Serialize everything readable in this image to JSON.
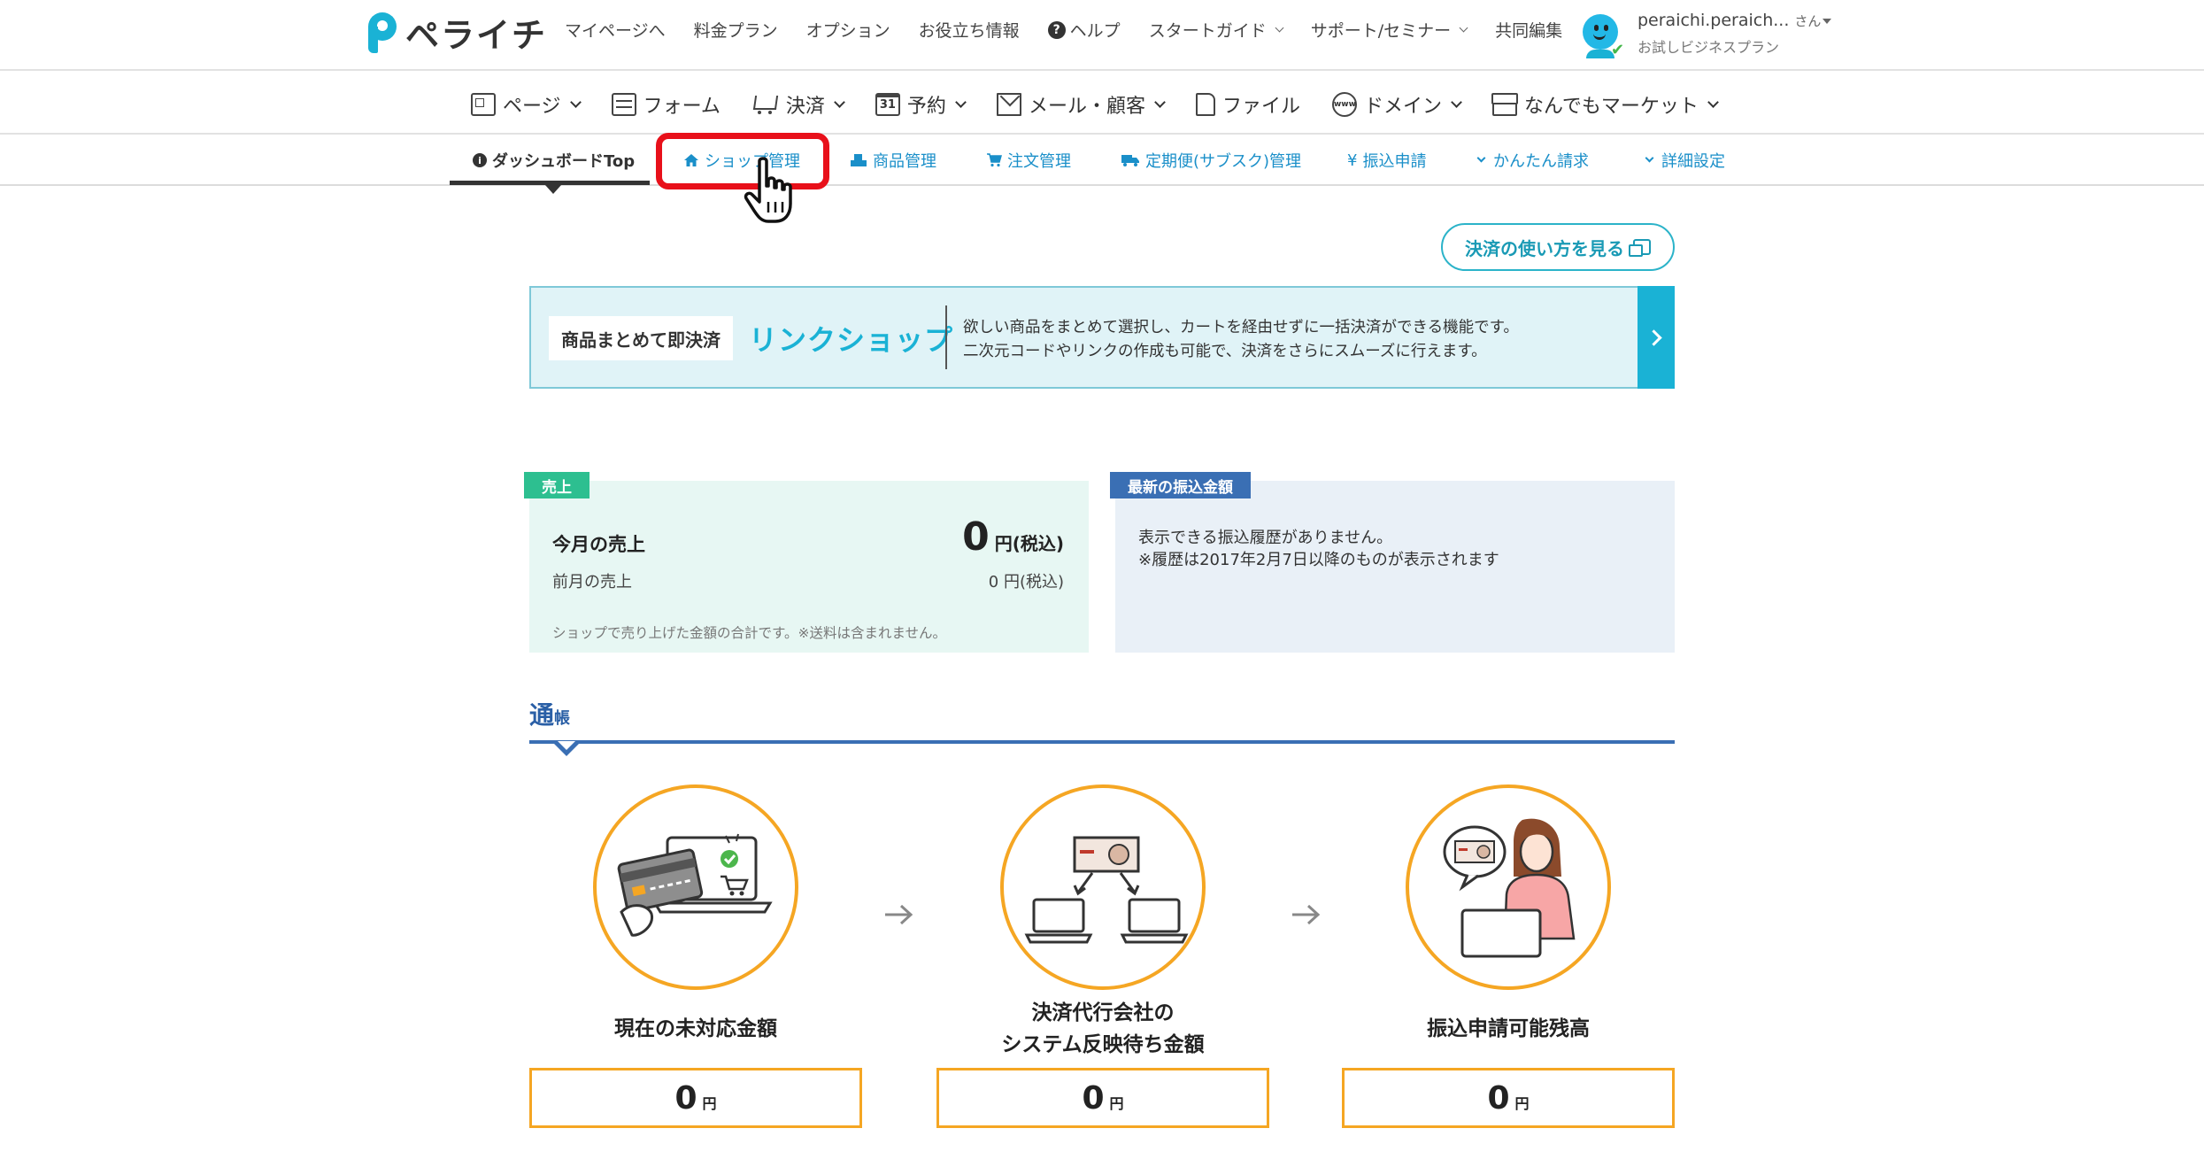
{
  "header": {
    "logo_text": "ペライチ",
    "nav": [
      {
        "label": "マイページへ",
        "dropdown": false
      },
      {
        "label": "料金プラン",
        "dropdown": false
      },
      {
        "label": "オプション",
        "dropdown": false
      },
      {
        "label": "お役立ち情報",
        "dropdown": false
      },
      {
        "label": "ヘルプ",
        "dropdown": false
      },
      {
        "label": "スタートガイド",
        "dropdown": true
      },
      {
        "label": "サポート/セミナー",
        "dropdown": true
      },
      {
        "label": "共同編集",
        "dropdown": false
      }
    ],
    "user": {
      "name": "peraichi.peraich...",
      "suffix": "さん",
      "plan": "お試しビジネスプラン"
    }
  },
  "main_nav": [
    {
      "label": "ページ",
      "icon": "page-icon"
    },
    {
      "label": "フォーム",
      "icon": "form-icon"
    },
    {
      "label": "決済",
      "icon": "cart-icon"
    },
    {
      "label": "予約",
      "icon": "calendar-icon"
    },
    {
      "label": "メール・顧客",
      "icon": "mail-icon"
    },
    {
      "label": "ファイル",
      "icon": "file-icon"
    },
    {
      "label": "ドメイン",
      "icon": "globe-icon"
    },
    {
      "label": "なんでもマーケット",
      "icon": "shop-icon"
    }
  ],
  "sub_nav": [
    {
      "label": "ダッシュボードTop",
      "icon": "info-icon",
      "active": true
    },
    {
      "label": "ショップ管理",
      "icon": "home-icon",
      "active": false
    },
    {
      "label": "商品管理",
      "icon": "products-icon",
      "active": false
    },
    {
      "label": "注文管理",
      "icon": "cart-icon",
      "active": false
    },
    {
      "label": "定期便(サブスク)管理",
      "icon": "truck-icon",
      "active": false
    },
    {
      "label": "振込申請",
      "icon": "yen-icon",
      "active": false
    },
    {
      "label": "かんたん請求",
      "icon": "chevron-down-icon",
      "active": false
    },
    {
      "label": "詳細設定",
      "icon": "chevron-down-icon",
      "active": false
    }
  ],
  "guide_button": "決済の使い方を見る",
  "banner": {
    "tag": "商品まとめて即決済",
    "title": "リンクショップ",
    "line1": "欲しい商品をまとめて選択し、カートを経由せずに一括決済ができる機能です。",
    "line2": "二次元コードやリンクの作成も可能で、決済をさらにスムーズに行えます。"
  },
  "sales": {
    "label": "売上",
    "this_month_label": "今月の売上",
    "this_month_value": "0",
    "this_month_unit": "円(税込)",
    "last_month_label": "前月の売上",
    "last_month_value": "0 円(税込)",
    "note": "ショップで売り上げた金額の合計です。※送料は含まれません。"
  },
  "deposit": {
    "label": "最新の振込金額",
    "line1": "表示できる振込履歴がありません。",
    "line2": "※履歴は2017年2月7日以降のものが表示されます"
  },
  "passbook": {
    "title_big": "通",
    "title_small": "帳",
    "steps": [
      {
        "label_lines": [
          "現在の未対応金額"
        ],
        "value": "0",
        "unit": "円"
      },
      {
        "label_lines": [
          "決済代行会社の",
          "システム反映待ち金額"
        ],
        "value": "0",
        "unit": "円"
      },
      {
        "label_lines": [
          "振込申請可能残高"
        ],
        "value": "0",
        "unit": "円"
      }
    ]
  },
  "colors": {
    "brand": "#1ab2d5",
    "link": "#1a8fc9",
    "sales_green": "#2dbf90",
    "deposit_blue": "#3a6fb4",
    "orange": "#f5a623",
    "highlight_red": "#e8101a"
  }
}
